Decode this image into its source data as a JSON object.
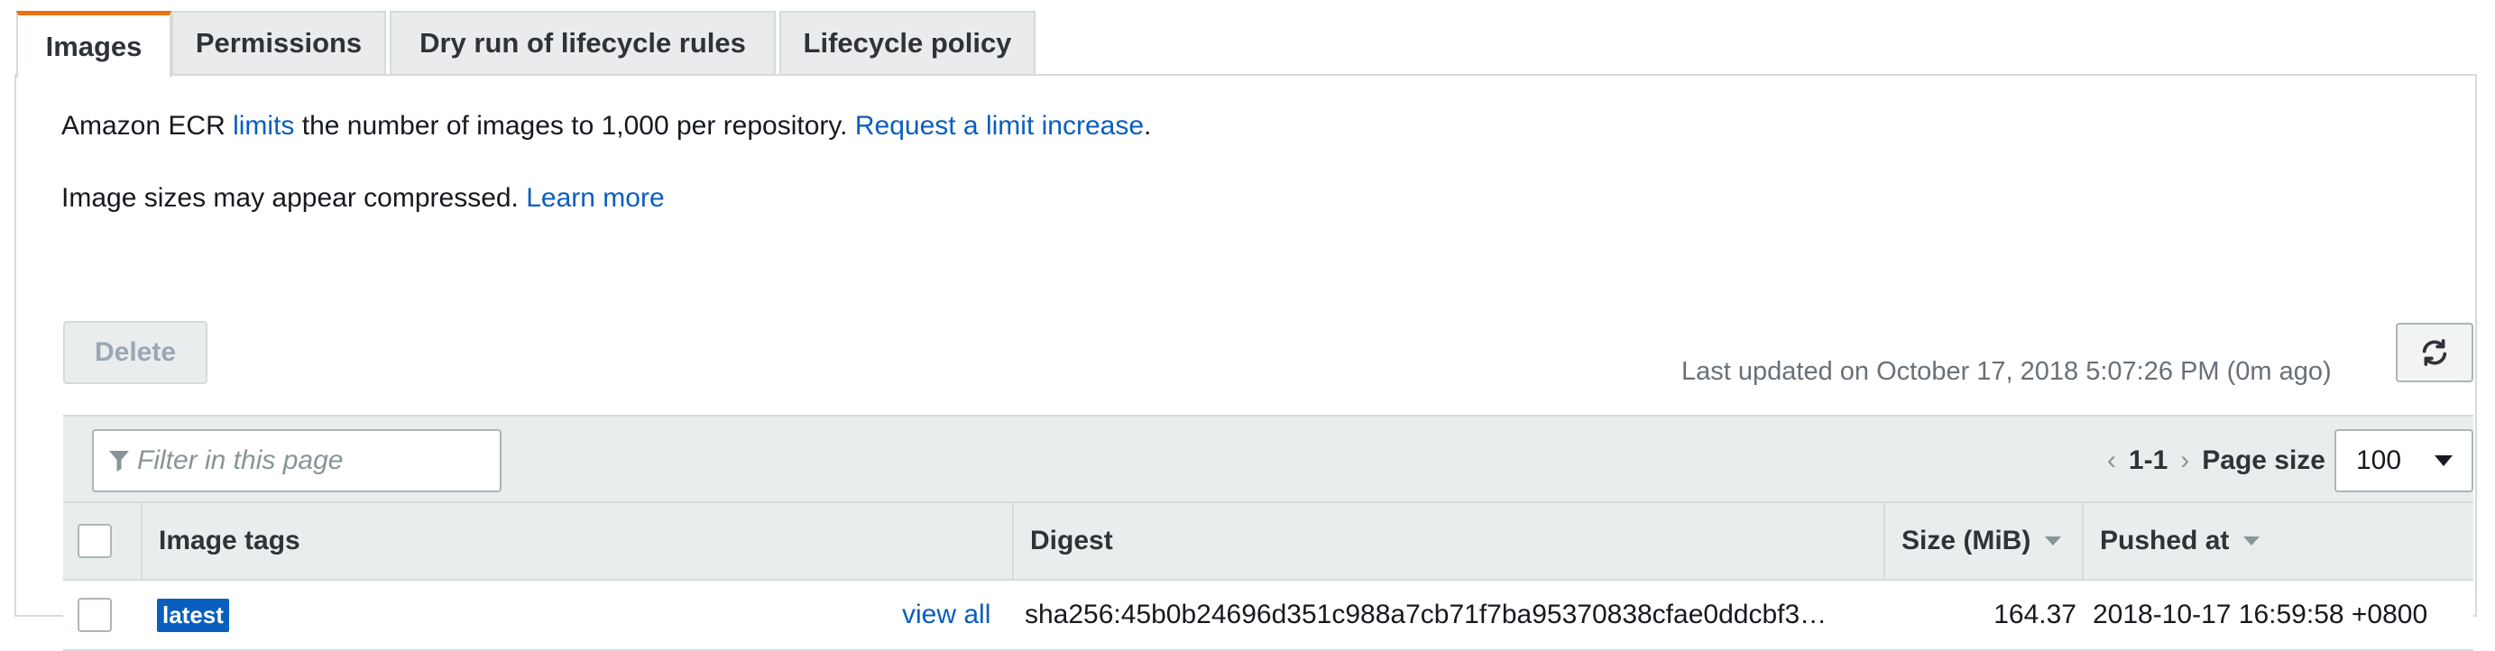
{
  "tabs": [
    {
      "label": "Images",
      "active": true
    },
    {
      "label": "Permissions",
      "active": false
    },
    {
      "label": "Dry run of lifecycle rules",
      "active": false
    },
    {
      "label": "Lifecycle policy",
      "active": false
    }
  ],
  "info": {
    "line1_prefix": "Amazon ECR ",
    "line1_link": "limits",
    "line1_middle": " the number of images to 1,000 per repository. ",
    "line1_link2": "Request a limit increase",
    "line1_suffix": ".",
    "line2_text": "Image sizes may appear compressed. ",
    "line2_link": "Learn more"
  },
  "actions": {
    "delete_label": "Delete",
    "last_updated": "Last updated on October 17, 2018 5:07:26 PM (0m ago)"
  },
  "filter": {
    "placeholder": "Filter in this page"
  },
  "pagination": {
    "prev": "‹",
    "range": "1-1",
    "next": "›",
    "page_size_label": "Page size",
    "page_size_value": "100"
  },
  "table": {
    "columns": [
      "Image tags",
      "Digest",
      "Size (MiB)",
      "Pushed at"
    ],
    "rows": [
      {
        "tag": "latest",
        "view_all": "view all",
        "digest": "sha256:45b0b24696d351c988a7cb71f7ba95370838cfae0ddcbf3…",
        "size": "164.37",
        "pushed_at": "2018-10-17 16:59:58 +0800"
      }
    ]
  },
  "colors": {
    "accent": "#ec7211",
    "link": "#0a5ebd"
  },
  "icons": {
    "refresh": "refresh-icon",
    "filter": "filter-icon",
    "sort": "sort-down-icon",
    "dropdown": "caret-down-icon"
  }
}
